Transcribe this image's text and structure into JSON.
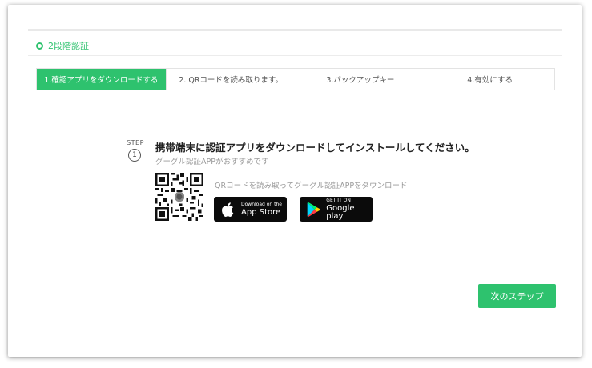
{
  "section": {
    "title": "2段階認証"
  },
  "tabs": [
    {
      "label": "1.確認アプリをダウンロードする",
      "active": true
    },
    {
      "label": "2. QRコードを読み取ります。",
      "active": false
    },
    {
      "label": "3.バックアップキー",
      "active": false
    },
    {
      "label": "4.有効にする",
      "active": false
    }
  ],
  "step": {
    "label": "STEP",
    "number": "1",
    "heading": "携帯端末に認証アプリをダウンロードしてインストールしてください。",
    "recommend": "グーグル認証APPがおすすめです",
    "qr_caption": "QRコードを読み取ってグーグル認証APPをダウンロード"
  },
  "stores": {
    "apple": {
      "small": "Download on the",
      "big": "App Store",
      "icon": "apple-icon"
    },
    "google": {
      "small": "GET IT ON",
      "big": "Google play",
      "icon": "google-play-icon"
    }
  },
  "actions": {
    "next_label": "次のステップ"
  },
  "colors": {
    "accent": "#2ec26e",
    "store_bg": "#0b0b0b"
  }
}
